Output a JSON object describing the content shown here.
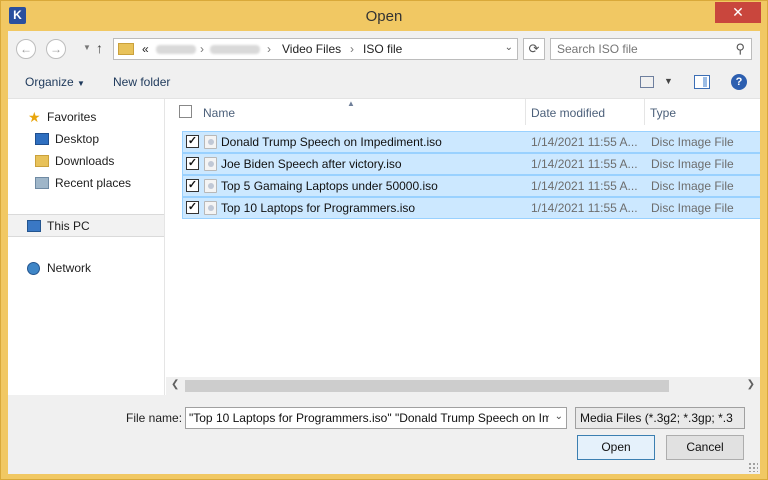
{
  "window": {
    "title": "Open",
    "app_icon": "K"
  },
  "address": {
    "overflow_marker": "«",
    "segments": [
      "Video Files",
      "ISO file"
    ]
  },
  "search": {
    "placeholder": "Search ISO file"
  },
  "toolbar": {
    "organize_label": "Organize",
    "new_folder_label": "New folder"
  },
  "nav": {
    "items": [
      {
        "label": "Favorites"
      },
      {
        "label": "Desktop"
      },
      {
        "label": "Downloads"
      },
      {
        "label": "Recent places"
      },
      {
        "label": "This PC"
      },
      {
        "label": "Network"
      }
    ]
  },
  "columns": {
    "name": "Name",
    "date": "Date modified",
    "type": "Type"
  },
  "files": [
    {
      "name": "Donald Trump Speech on Impediment.iso",
      "date": "1/14/2021 11:55 A...",
      "type": "Disc Image File",
      "checked": true
    },
    {
      "name": "Joe Biden Speech after victory.iso",
      "date": "1/14/2021 11:55 A...",
      "type": "Disc Image File",
      "checked": true
    },
    {
      "name": "Top 5 Gamaing Laptops under 50000.iso",
      "date": "1/14/2021 11:55 A...",
      "type": "Disc Image File",
      "checked": true
    },
    {
      "name": "Top 10 Laptops for Programmers.iso",
      "date": "1/14/2021 11:55 A...",
      "type": "Disc Image File",
      "checked": true
    }
  ],
  "bottom": {
    "file_name_label": "File name:",
    "file_name_value": "\"Top 10 Laptops for Programmers.iso\" \"Donald Trump Speech on Im",
    "filter_value": "Media Files (*.3g2; *.3gp; *.3",
    "open_label": "Open",
    "cancel_label": "Cancel"
  },
  "check_mark": "✓",
  "colors": {
    "selection_bg": "#cce8ff",
    "selection_border": "#99d1ff",
    "title_bar": "#f1c863",
    "close_button": "#c9463d"
  }
}
